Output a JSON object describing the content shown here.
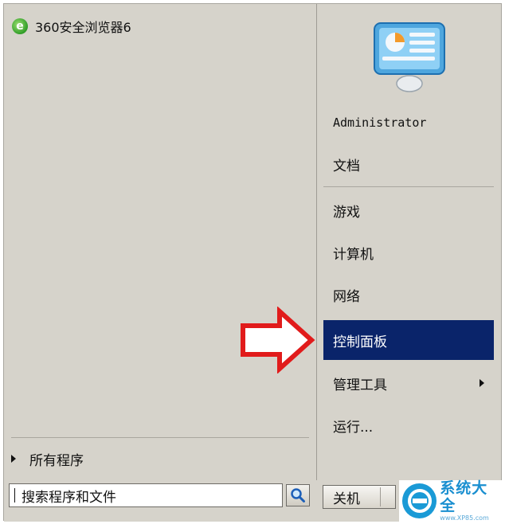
{
  "pinned": {
    "browser_label": "360安全浏览器6",
    "browser_icon": "360-browser-icon"
  },
  "all_programs": {
    "label": "所有程序"
  },
  "right_menu": {
    "user_name": "Administrator",
    "items": [
      {
        "label": "文档"
      },
      {
        "label": "游戏"
      },
      {
        "label": "计算机"
      },
      {
        "label": "网络"
      },
      {
        "label": "控制面板",
        "highlighted": true
      },
      {
        "label": "管理工具",
        "has_submenu": true
      },
      {
        "label": "运行..."
      }
    ]
  },
  "search": {
    "value": "搜索程序和文件"
  },
  "shutdown": {
    "label": "关机"
  },
  "watermark": {
    "title": "系统大全",
    "sub": "www.XP85.com"
  },
  "colors": {
    "highlight": "#0a246a",
    "arrow": "#e11b1b",
    "menu_bg": "#d6d3cb"
  }
}
